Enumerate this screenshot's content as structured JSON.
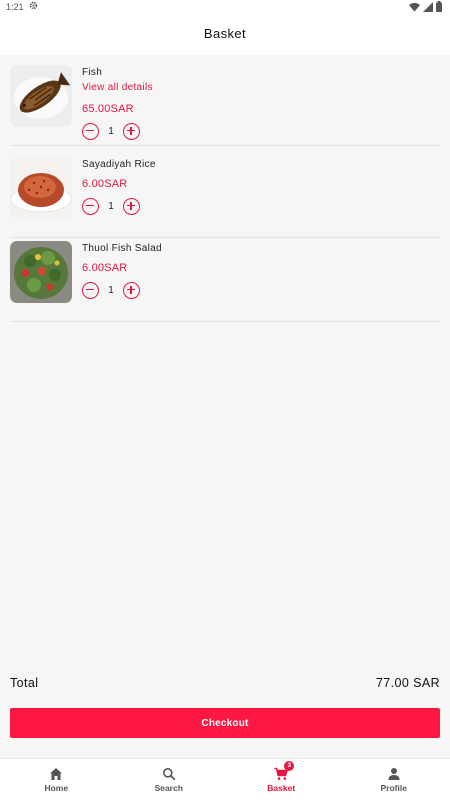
{
  "status_bar": {
    "time": "1:21"
  },
  "header": {
    "title": "Basket"
  },
  "items": [
    {
      "name": "Fish",
      "details_link": "View all details",
      "price": "65.00SAR",
      "quantity": "1"
    },
    {
      "name": "Sayadiyah Rice",
      "price": "6.00SAR",
      "quantity": "1"
    },
    {
      "name": "Thuol Fish Salad",
      "price": "6.00SAR",
      "quantity": "1"
    }
  ],
  "summary": {
    "total_label": "Total",
    "total_value": "77.00 SAR"
  },
  "checkout": {
    "label": "Checkout"
  },
  "nav": {
    "items": [
      {
        "label": "Home",
        "icon": "home-icon"
      },
      {
        "label": "Search",
        "icon": "search-icon"
      },
      {
        "label": "Basket",
        "icon": "cart-icon",
        "badge": "3"
      },
      {
        "label": "Profile",
        "icon": "person-icon"
      }
    ],
    "active": "Basket"
  },
  "colors": {
    "accent": "#e3163f",
    "checkout_bg": "#ff1744",
    "background": "#f6f6f6"
  }
}
